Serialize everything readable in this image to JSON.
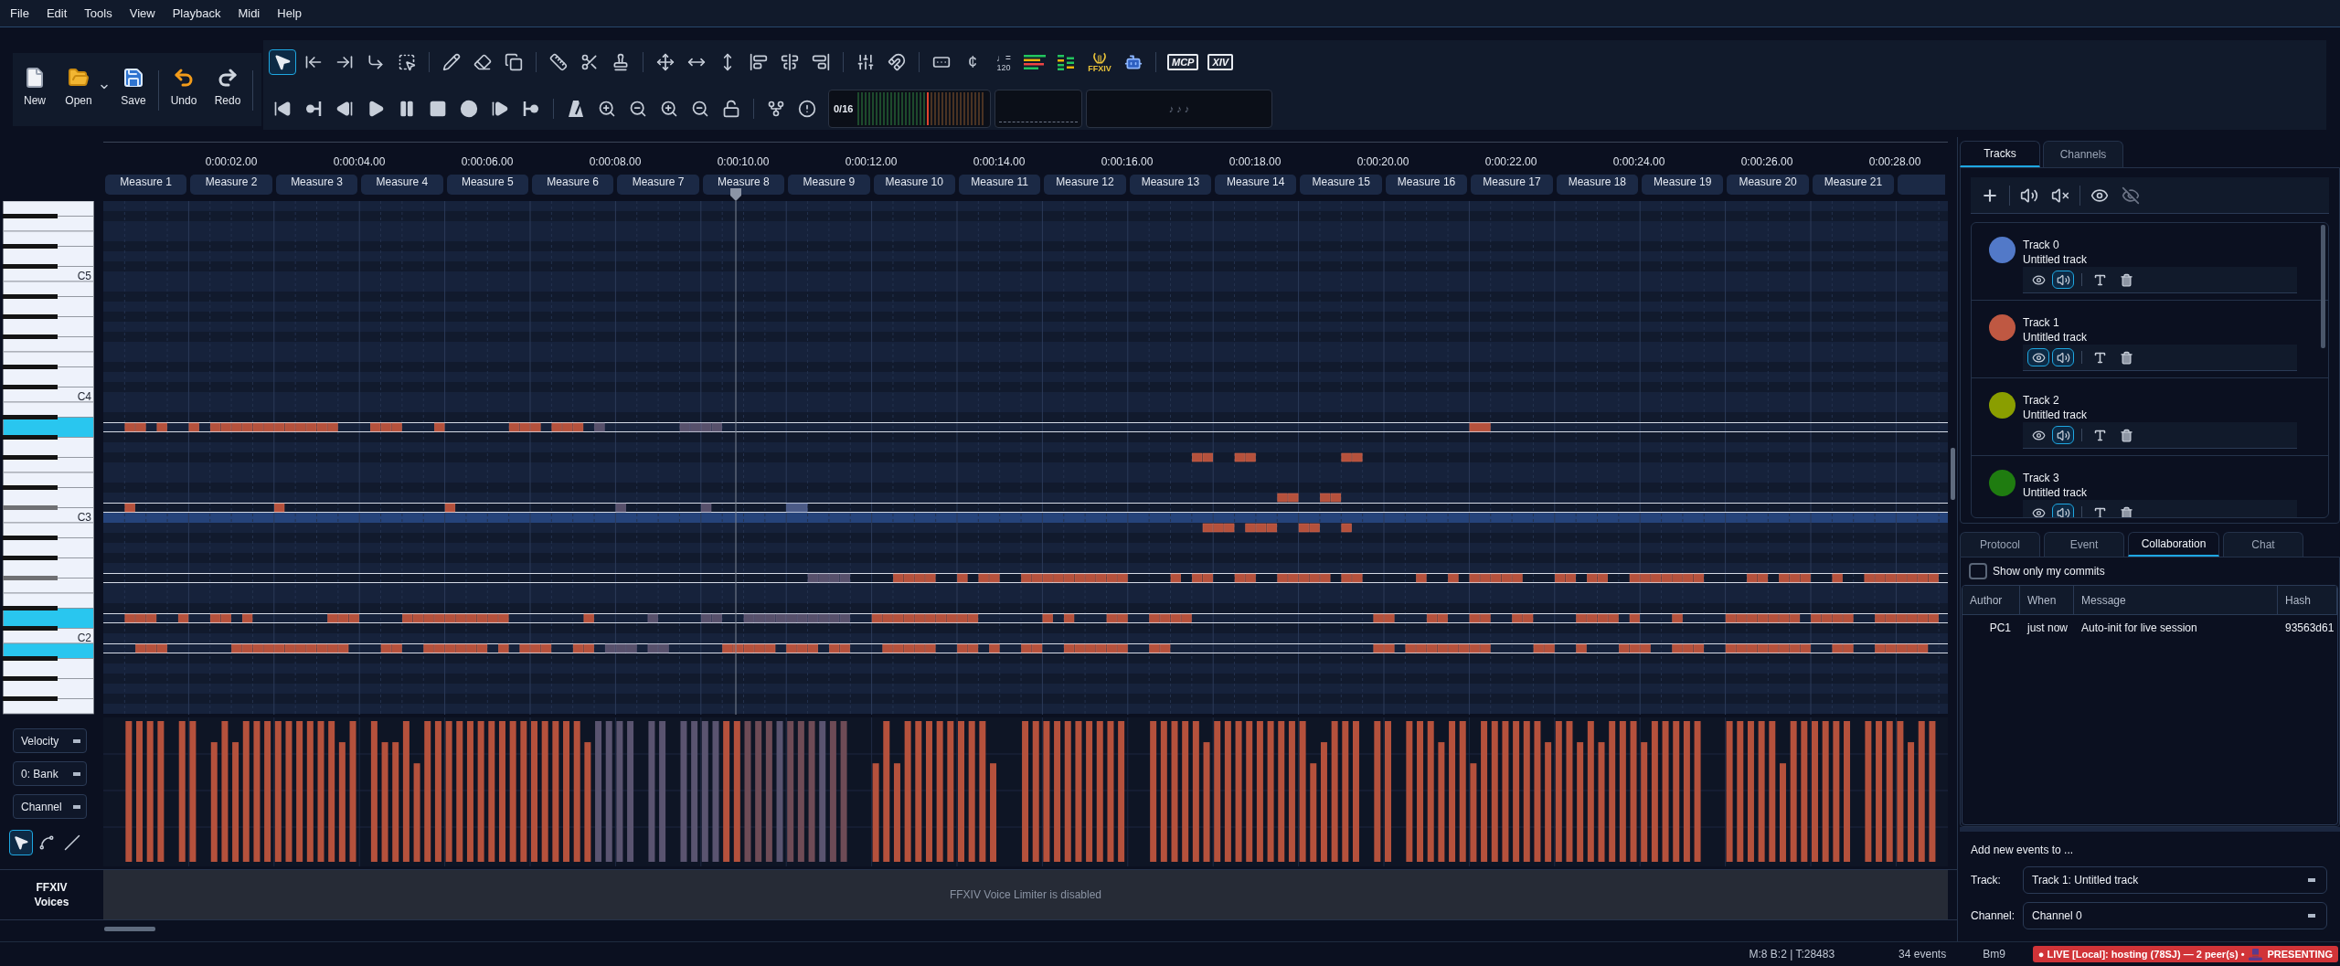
{
  "menu": [
    "File",
    "Edit",
    "Tools",
    "View",
    "Playback",
    "Midi",
    "Help"
  ],
  "file_actions": [
    {
      "label": "New",
      "dropdown": false
    },
    {
      "label": "Open",
      "dropdown": true
    },
    {
      "label": "Save",
      "dropdown": false
    },
    {
      "label": "Undo",
      "dropdown": false
    },
    {
      "label": "Redo",
      "dropdown": false
    }
  ],
  "toolbar": {
    "mode_tools": [
      {
        "selected": true
      },
      {
        "selected": false
      },
      {
        "selected": false
      },
      {
        "selected": false
      },
      {
        "selected": false
      }
    ],
    "cent_label": "¢",
    "tempo": {
      "note": "♩=",
      "bpm": "120"
    },
    "lyre_caption": "FFXIV",
    "logo_badges": [
      "MCP",
      "XIV"
    ],
    "voice_meter": "0/16",
    "note_display": "♪ ♪ ♪"
  },
  "timeline": {
    "time_labels": [
      "0:00:02.00",
      "0:00:04.00",
      "0:00:06.00",
      "0:00:08.00",
      "0:00:10.00",
      "0:00:12.00",
      "0:00:14.00",
      "0:00:16.00",
      "0:00:18.00",
      "0:00:20.00",
      "0:00:22.00",
      "0:00:24.00",
      "0:00:26.00",
      "0:00:28.00"
    ],
    "measures": [
      "Measure 1",
      "Measure 2",
      "Measure 3",
      "Measure 4",
      "Measure 5",
      "Measure 6",
      "Measure 7",
      "Measure 8",
      "Measure 9",
      "Measure 10",
      "Measure 11",
      "Measure 12",
      "Measure 13",
      "Measure 14",
      "Measure 15",
      "Measure 16",
      "Measure 17",
      "Measure 18",
      "Measure 19",
      "Measure 20",
      "Measure 21"
    ]
  },
  "keyboard": {
    "octave_labels": [
      "C5",
      "C4",
      "C3",
      "C2"
    ]
  },
  "controllers": {
    "selects": [
      "Velocity",
      "0: Bank",
      "Channel"
    ],
    "draw_tools": [
      {
        "selected": true
      },
      {
        "selected": false
      },
      {
        "selected": false
      }
    ]
  },
  "voices": {
    "label": "FFXIV Voices",
    "message": "FFXIV Voice Limiter is disabled"
  },
  "tracks_panel": {
    "tabs": [
      {
        "label": "Tracks",
        "selected": true
      },
      {
        "label": "Channels",
        "selected": false
      }
    ],
    "tracks": [
      {
        "name": "Track 0",
        "subtitle": "Untitled track",
        "color": "#5279c8",
        "eye_on": false,
        "sound_on": true
      },
      {
        "name": "Track 1",
        "subtitle": "Untitled track",
        "color": "#bf5842",
        "eye_on": true,
        "sound_on": true
      },
      {
        "name": "Track 2",
        "subtitle": "Untitled track",
        "color": "#8a9e00",
        "eye_on": false,
        "sound_on": true
      },
      {
        "name": "Track 3",
        "subtitle": "Untitled track",
        "color": "#1f7c10",
        "eye_on": false,
        "sound_on": true
      }
    ]
  },
  "info_panel": {
    "tabs": [
      {
        "label": "Protocol",
        "selected": false
      },
      {
        "label": "Event",
        "selected": false
      },
      {
        "label": "Collaboration",
        "selected": true
      },
      {
        "label": "Chat",
        "selected": false
      }
    ],
    "filter": {
      "label": "Show only my commits",
      "checked": false
    },
    "table": {
      "columns": [
        "Author",
        "When",
        "Message",
        "Hash"
      ],
      "rows": [
        [
          "PC1",
          "just now",
          "Auto-init for live session",
          "93563d61"
        ]
      ]
    }
  },
  "add_events": {
    "title": "Add new events to ...",
    "fields": [
      {
        "label": "Track:",
        "value": "Track 1: Untitled track"
      },
      {
        "label": "Channel:",
        "value": "Channel 0"
      }
    ]
  },
  "status_bar": {
    "position": "M:8 B:2 | T:28483",
    "events": "34 events",
    "chord": "Bm9",
    "live": {
      "text": "● LIVE [Local]: hosting (78SJ) — 2 peer(s) •",
      "mode": "PRESENTING"
    }
  }
}
